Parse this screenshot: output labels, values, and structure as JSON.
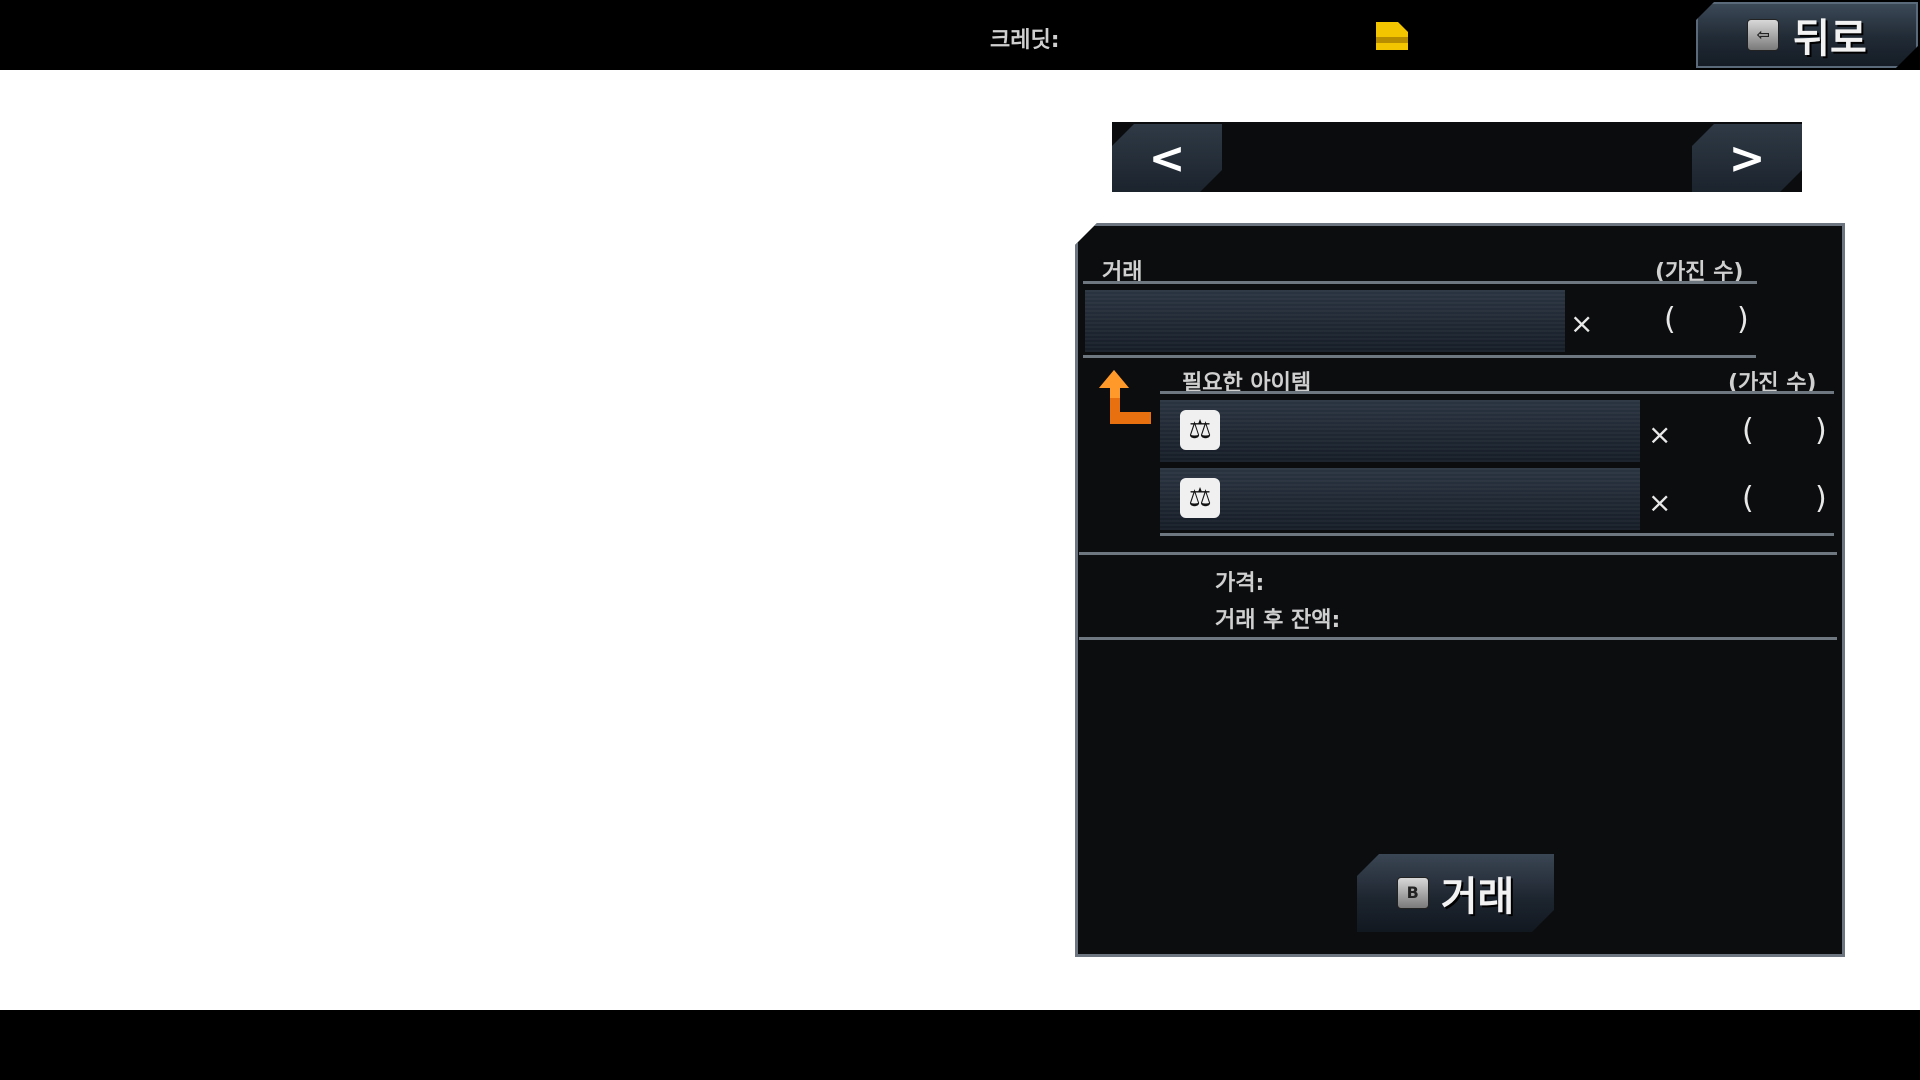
{
  "top_bar": {
    "credits_label": "크레딧:",
    "credits_icon": "credit-chip-icon",
    "back_label": "뒤로",
    "back_key_icon": "back-key-icon"
  },
  "navigation": {
    "prev_glyph": "<",
    "next_glyph": ">",
    "prev_icon": "chevron-left-icon",
    "next_icon": "chevron-right-icon"
  },
  "trade_panel": {
    "header_label": "거래",
    "header_owned_label": "(가진 수)",
    "output_item": {
      "multiplier": "×",
      "paren_open": "(",
      "paren_close": ")"
    },
    "required_label": "필요한 아이템",
    "required_owned_label": "(가진 수)",
    "required_items": [
      {
        "icon": "scale-icon",
        "multiplier": "×",
        "paren_open": "(",
        "paren_close": ")"
      },
      {
        "icon": "scale-icon",
        "multiplier": "×",
        "paren_open": "(",
        "paren_close": ")"
      }
    ],
    "price_label": "가격:",
    "balance_label": "거래 후 잔액:",
    "trade_button_label": "거래",
    "trade_key_icon": "b-key-icon"
  },
  "colors": {
    "bars": "#000000",
    "panel_bg": "#0c0d0f",
    "panel_border": "#6d7680",
    "accent_orange": "#f07a10",
    "credit_chip": "#f2c500"
  }
}
